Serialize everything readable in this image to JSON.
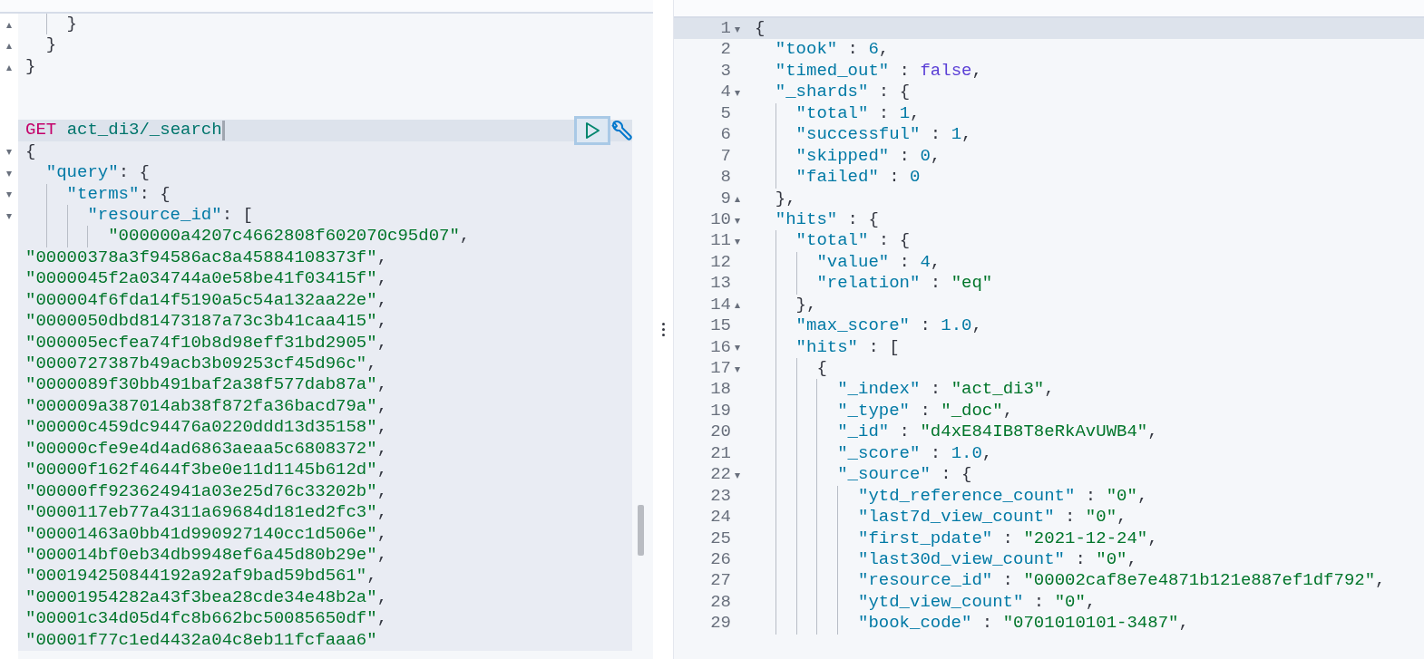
{
  "request_editor": {
    "blocks": [
      {
        "selected": false,
        "lines": [
          {
            "kind": "code",
            "text": "    }",
            "fold": "▴",
            "active": false
          },
          {
            "kind": "code",
            "text": "  }",
            "fold": "▴",
            "active": false
          },
          {
            "kind": "code",
            "text": "}",
            "fold": "▴",
            "active": false
          },
          {
            "kind": "blank",
            "active": false
          },
          {
            "kind": "blank",
            "active": false
          }
        ]
      },
      {
        "selected": true,
        "lines": [
          {
            "kind": "request",
            "method": "GET",
            "path": "act_di3/_search",
            "active": true
          },
          {
            "kind": "code",
            "text": "{",
            "fold": "▾",
            "active": false
          },
          {
            "kind": "code",
            "text": "  \"query\": {",
            "fold": "▾",
            "active": false
          },
          {
            "kind": "code",
            "text": "    \"terms\": {",
            "fold": "▾",
            "active": false
          },
          {
            "kind": "code",
            "text": "      \"resource_id\": [",
            "fold": "▾",
            "active": false
          },
          {
            "kind": "code",
            "text": "        \"000000a4207c4662808f602070c95d07\",",
            "active": false
          },
          {
            "kind": "code",
            "text": "\"00000378a3f94586ac8a45884108373f\",",
            "active": false
          },
          {
            "kind": "code",
            "text": "\"0000045f2a034744a0e58be41f03415f\",",
            "active": false
          },
          {
            "kind": "code",
            "text": "\"000004f6fda14f5190a5c54a132aa22e\",",
            "active": false
          },
          {
            "kind": "code",
            "text": "\"0000050dbd81473187a73c3b41caa415\",",
            "active": false
          },
          {
            "kind": "code",
            "text": "\"000005ecfea74f10b8d98eff31bd2905\",",
            "active": false
          },
          {
            "kind": "code",
            "text": "\"0000727387b49acb3b09253cf45d96c\",",
            "active": false
          },
          {
            "kind": "code",
            "text": "\"0000089f30bb491baf2a38f577dab87a\",",
            "active": false
          },
          {
            "kind": "code",
            "text": "\"000009a387014ab38f872fa36bacd79a\",",
            "active": false
          },
          {
            "kind": "code",
            "text": "\"00000c459dc94476a0220ddd13d35158\",",
            "active": false
          },
          {
            "kind": "code",
            "text": "\"00000cfe9e4d4ad6863aeaa5c6808372\",",
            "active": false
          },
          {
            "kind": "code",
            "text": "\"00000f162f4644f3be0e11d1145b612d\",",
            "active": false
          },
          {
            "kind": "code",
            "text": "\"00000ff923624941a03e25d76c33202b\",",
            "active": false
          },
          {
            "kind": "code",
            "text": "\"0000117eb77a4311a69684d181ed2fc3\",",
            "active": false
          },
          {
            "kind": "code",
            "text": "\"00001463a0bb41d990927140cc1d506e\",",
            "active": false
          },
          {
            "kind": "code",
            "text": "\"000014bf0eb34db9948ef6a45d80b29e\",",
            "active": false
          },
          {
            "kind": "code",
            "text": "\"000194250844192a92af9bad59bd561\",",
            "active": false
          },
          {
            "kind": "code",
            "text": "\"00001954282a43f3bea28cde34e48b2a\",",
            "active": false
          },
          {
            "kind": "code",
            "text": "\"00001c34d05d4fc8b662bc50085650df\",",
            "active": false
          },
          {
            "kind": "code",
            "text": "\"00001f77c1ed4432a04c8eb11fcfaaa6\"",
            "active": false
          }
        ]
      }
    ]
  },
  "response_viewer": {
    "lines": [
      {
        "number": "1",
        "text": "{",
        "fold": "▾",
        "active": true
      },
      {
        "number": "2",
        "text": "  \"took\" : 6,",
        "active": false
      },
      {
        "number": "3",
        "text": "  \"timed_out\" : false,",
        "active": false
      },
      {
        "number": "4",
        "text": "  \"_shards\" : {",
        "fold": "▾",
        "active": false
      },
      {
        "number": "5",
        "text": "    \"total\" : 1,",
        "active": false
      },
      {
        "number": "6",
        "text": "    \"successful\" : 1,",
        "active": false
      },
      {
        "number": "7",
        "text": "    \"skipped\" : 0,",
        "active": false
      },
      {
        "number": "8",
        "text": "    \"failed\" : 0",
        "active": false
      },
      {
        "number": "9",
        "text": "  },",
        "fold": "▴",
        "active": false
      },
      {
        "number": "10",
        "text": "  \"hits\" : {",
        "fold": "▾",
        "active": false
      },
      {
        "number": "11",
        "text": "    \"total\" : {",
        "fold": "▾",
        "active": false
      },
      {
        "number": "12",
        "text": "      \"value\" : 4,",
        "active": false
      },
      {
        "number": "13",
        "text": "      \"relation\" : \"eq\"",
        "active": false
      },
      {
        "number": "14",
        "text": "    },",
        "fold": "▴",
        "active": false
      },
      {
        "number": "15",
        "text": "    \"max_score\" : 1.0,",
        "active": false
      },
      {
        "number": "16",
        "text": "    \"hits\" : [",
        "fold": "▾",
        "active": false
      },
      {
        "number": "17",
        "text": "      {",
        "fold": "▾",
        "active": false
      },
      {
        "number": "18",
        "text": "        \"_index\" : \"act_di3\",",
        "active": false
      },
      {
        "number": "19",
        "text": "        \"_type\" : \"_doc\",",
        "active": false
      },
      {
        "number": "20",
        "text": "        \"_id\" : \"d4xE84IB8T8eRkAvUWB4\",",
        "active": false
      },
      {
        "number": "21",
        "text": "        \"_score\" : 1.0,",
        "active": false
      },
      {
        "number": "22",
        "text": "        \"_source\" : {",
        "fold": "▾",
        "active": false
      },
      {
        "number": "23",
        "text": "          \"ytd_reference_count\" : \"0\",",
        "active": false
      },
      {
        "number": "24",
        "text": "          \"last7d_view_count\" : \"0\",",
        "active": false
      },
      {
        "number": "25",
        "text": "          \"first_pdate\" : \"2021-12-24\",",
        "active": false
      },
      {
        "number": "26",
        "text": "          \"last30d_view_count\" : \"0\",",
        "active": false
      },
      {
        "number": "27",
        "text": "          \"resource_id\" : \"00002caf8e7e4871b121e887ef1df792\",",
        "active": false
      },
      {
        "number": "28",
        "text": "          \"ytd_view_count\" : \"0\",",
        "active": false
      },
      {
        "number": "29",
        "text": "          \"book_code\" : \"0701010101-3487\",",
        "active": false
      }
    ]
  }
}
